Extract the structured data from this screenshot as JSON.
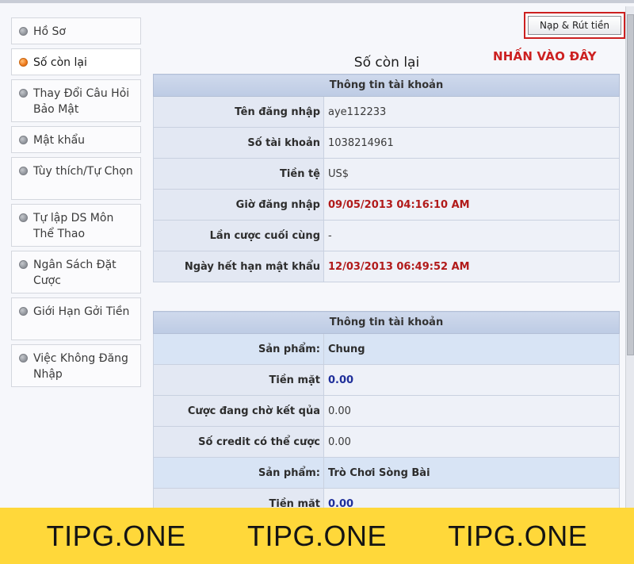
{
  "sidebar": {
    "items": [
      {
        "label": "Hồ Sơ",
        "active": false
      },
      {
        "label": "Số còn lại",
        "active": true
      },
      {
        "label": "Thay Đổi Câu Hỏi Bảo Mật",
        "active": false
      },
      {
        "label": "Mật khẩu",
        "active": false
      },
      {
        "label": "Tùy thích/Tự Chọn",
        "active": false
      },
      {
        "label": "Tự lập DS Môn Thể Thao",
        "active": false
      },
      {
        "label": "Ngân Sách Đặt Cược",
        "active": false
      },
      {
        "label": "Giới Hạn Gởi Tiền",
        "active": false
      },
      {
        "label": "Việc Không Đăng Nhập",
        "active": false
      }
    ]
  },
  "toolbar": {
    "deposit_withdraw_label": "Nạp & Rút tiền",
    "click_here_note": "NHẤN VÀO ĐÂY"
  },
  "page": {
    "title": "Số còn lại"
  },
  "account_info": {
    "header": "Thông tin tài khoản",
    "rows": [
      {
        "label": "Tên đăng nhập",
        "value": "aye112233"
      },
      {
        "label": "Số tài khoản",
        "value": "1038214961"
      },
      {
        "label": "Tiền tệ",
        "value": "US$"
      },
      {
        "label": "Giờ đăng nhập",
        "value": "09/05/2013 04:16:10 AM"
      },
      {
        "label": "Lần cược cuối cùng",
        "value": "-"
      },
      {
        "label": "Ngày hết hạn mật khẩu",
        "value": "12/03/2013 06:49:52 AM"
      }
    ]
  },
  "balance_info": {
    "header": "Thông tin tài khoản",
    "rows": [
      {
        "label": "Sản phẩm:",
        "value": "Chung"
      },
      {
        "label": "Tiền mặt",
        "value": "0.00"
      },
      {
        "label": "Cược đang chờ kết qủa",
        "value": "0.00"
      },
      {
        "label": "Số credit có thể cược",
        "value": "0.00"
      },
      {
        "label": "Sản phẩm:",
        "value": "Trò Chơi Sòng Bài"
      },
      {
        "label": "Tiền mặt",
        "value": "0.00"
      }
    ]
  },
  "watermark": {
    "texts": [
      "TIPG.ONE",
      "TIPG.ONE",
      "TIPG.ONE"
    ]
  },
  "colors": {
    "highlight_red": "#cc2020",
    "value_red": "#b11a1a",
    "value_blue": "#1f2f9a",
    "table_header": "#c6d2e8",
    "banner_yellow": "#ffd83a"
  }
}
